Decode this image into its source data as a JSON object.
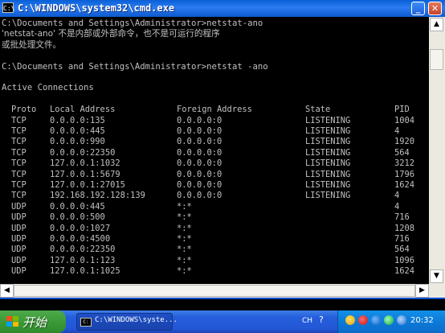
{
  "window": {
    "title": "C:\\WINDOWS\\system32\\cmd.exe",
    "icon_label": "C:\\",
    "icons": {
      "minimize": "minimize-icon",
      "maximize": "maximize-icon",
      "close": "close-icon"
    },
    "minimize_glyph": "_",
    "close_glyph": "✕"
  },
  "console": {
    "lines": [
      "C:\\Documents and Settings\\Administrator>netstat-ano",
      "'netstat-ano' 不是内部或外部命令，也不是可运行的程序",
      "或批处理文件。",
      "",
      "C:\\Documents and Settings\\Administrator>netstat -ano",
      "",
      "Active Connections",
      ""
    ],
    "table": {
      "headers": [
        "Proto",
        "Local Address",
        "Foreign Address",
        "State",
        "PID"
      ],
      "rows": [
        [
          "TCP",
          "0.0.0.0:135",
          "0.0.0.0:0",
          "LISTENING",
          "1004"
        ],
        [
          "TCP",
          "0.0.0.0:445",
          "0.0.0.0:0",
          "LISTENING",
          "4"
        ],
        [
          "TCP",
          "0.0.0.0:990",
          "0.0.0.0:0",
          "LISTENING",
          "1920"
        ],
        [
          "TCP",
          "0.0.0.0:22350",
          "0.0.0.0:0",
          "LISTENING",
          "564"
        ],
        [
          "TCP",
          "127.0.0.1:1032",
          "0.0.0.0:0",
          "LISTENING",
          "3212"
        ],
        [
          "TCP",
          "127.0.0.1:5679",
          "0.0.0.0:0",
          "LISTENING",
          "1796"
        ],
        [
          "TCP",
          "127.0.0.1:27015",
          "0.0.0.0:0",
          "LISTENING",
          "1624"
        ],
        [
          "TCP",
          "192.168.192.128:139",
          "0.0.0.0:0",
          "LISTENING",
          "4"
        ],
        [
          "UDP",
          "0.0.0.0:445",
          "*:*",
          "",
          "4"
        ],
        [
          "UDP",
          "0.0.0.0:500",
          "*:*",
          "",
          "716"
        ],
        [
          "UDP",
          "0.0.0.0:1027",
          "*:*",
          "",
          "1208"
        ],
        [
          "UDP",
          "0.0.0.0:4500",
          "*:*",
          "",
          "716"
        ],
        [
          "UDP",
          "0.0.0.0:22350",
          "*:*",
          "",
          "564"
        ],
        [
          "UDP",
          "127.0.0.1:123",
          "*:*",
          "",
          "1096"
        ],
        [
          "UDP",
          "127.0.0.1:1025",
          "*:*",
          "",
          "1624"
        ]
      ]
    },
    "text_color": "#c0c0c0",
    "background": "#000000"
  },
  "scrollbars": {
    "up_glyph": "▲",
    "down_glyph": "▼",
    "left_glyph": "◀",
    "right_glyph": "▶"
  },
  "taskbar": {
    "start_label": "开始",
    "task_label": "C:\\WINDOWS\\syste...",
    "language": "CH",
    "help_glyph": "?",
    "clock": "20:32",
    "start_color": "#3c9a38",
    "taskbar_color": "#245edb",
    "tray_color": "#0d7ad8"
  }
}
